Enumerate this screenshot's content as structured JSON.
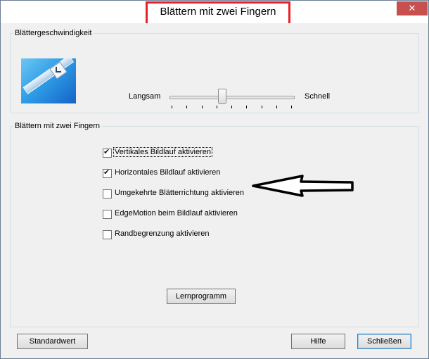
{
  "window": {
    "title": "Blättern mit zwei Fingern",
    "close_symbol": "✕"
  },
  "speed_group": {
    "legend": "Blättergeschwindigkeit",
    "image_icon": "touchpad-scroll-illustration",
    "slow_label": "Langsam",
    "fast_label": "Schnell",
    "speed_fraction": 0.42,
    "tick_count": 9
  },
  "finger_group": {
    "legend": "Blättern mit zwei Fingern",
    "options": [
      {
        "label": "Vertikales Bildlauf aktivieren",
        "checked": true
      },
      {
        "label": "Horizontales Bildlauf aktivieren",
        "checked": true
      },
      {
        "label": "Umgekehrte Blätterrichtung aktivieren",
        "checked": false
      },
      {
        "label": "EdgeMotion beim Bildlauf aktivieren",
        "checked": false
      },
      {
        "label": "Randbegrenzung aktivieren",
        "checked": false
      }
    ],
    "tutorial_button": "Lernprogramm"
  },
  "footer": {
    "default_button": "Standardwert",
    "help_button": "Hilfe",
    "close_button": "Schließen"
  },
  "annotation": {
    "arrow_color": "#000000",
    "title_highlight_color": "#e8202a"
  }
}
